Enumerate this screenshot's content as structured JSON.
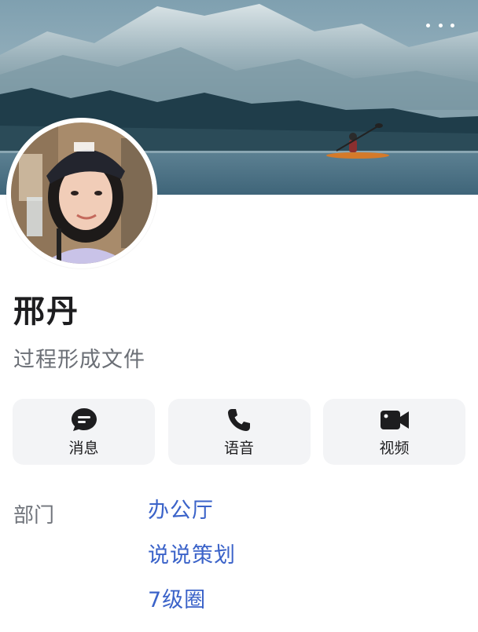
{
  "profile": {
    "name": "邢丹",
    "signature": "过程形成文件"
  },
  "actions": [
    {
      "label": "消息",
      "icon": "chat-bubble-icon"
    },
    {
      "label": "语音",
      "icon": "phone-icon"
    },
    {
      "label": "视频",
      "icon": "video-camera-icon"
    }
  ],
  "department": {
    "label": "部门",
    "items": [
      "办公厅",
      "说说策划",
      "7级圈"
    ]
  },
  "colors": {
    "link": "#3b63c9",
    "button_bg": "#f3f4f6",
    "icon": "#1d1d1f"
  }
}
